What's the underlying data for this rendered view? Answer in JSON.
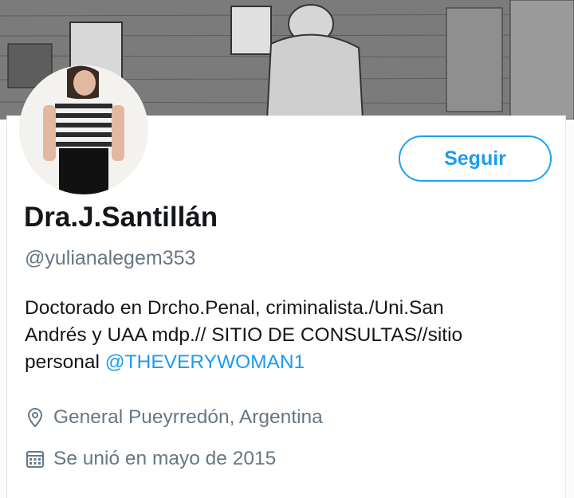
{
  "profile": {
    "name": "Dra.J.Santillán",
    "handle": "@yulianalegem353",
    "bio_line1": "Doctorado en Drcho.Penal, criminalista./Uni.San",
    "bio_line2": "Andrés y UAA mdp.// SITIO DE CONSULTAS//sitio",
    "bio_line3_prefix": "personal ",
    "bio_mention": "@THEVERYWOMAN1",
    "location": "General Pueyrredón, Argentina",
    "joined": "Se unió en mayo de 2015"
  },
  "actions": {
    "follow_label": "Seguir"
  },
  "icons": {
    "location": "location-pin-icon",
    "joined": "calendar-icon"
  },
  "colors": {
    "accent": "#1d9bf0",
    "secondary_text": "#657786",
    "primary_text": "#14171a"
  }
}
